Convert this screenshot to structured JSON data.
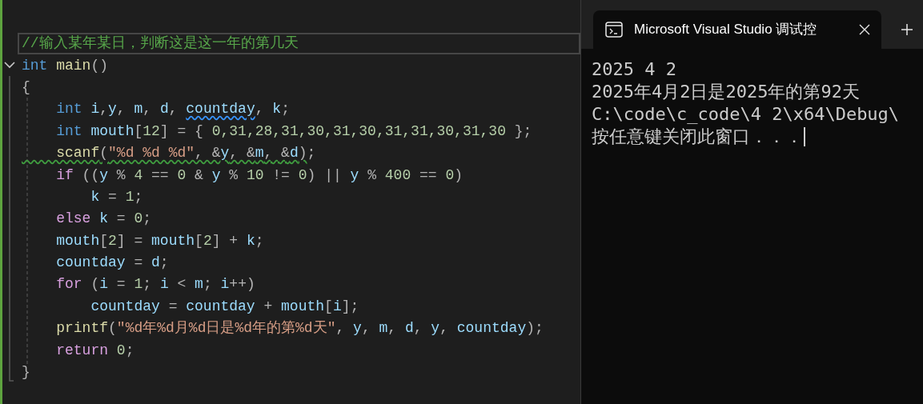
{
  "editor": {
    "lines": [
      {
        "current": true,
        "foldable": false,
        "tokens": [
          {
            "kind": "comment",
            "text": "//输入某年某日，判断这是这一年的第几天"
          }
        ]
      },
      {
        "current": false,
        "foldable": true,
        "tokens": [
          {
            "kind": "keyword",
            "text": "int"
          },
          {
            "kind": "function",
            "text": " main"
          },
          {
            "kind": "plain",
            "text": "()"
          }
        ]
      },
      {
        "current": false,
        "foldable": false,
        "tokens": [
          {
            "kind": "plain",
            "text": "{"
          }
        ]
      },
      {
        "current": false,
        "foldable": false,
        "tokens": [
          {
            "kind": "keyword",
            "text": "    int"
          },
          {
            "kind": "variable",
            "text": " i"
          },
          {
            "kind": "plain",
            "text": ","
          },
          {
            "kind": "variable",
            "text": "y"
          },
          {
            "kind": "plain",
            "text": ", "
          },
          {
            "kind": "variable",
            "text": "m"
          },
          {
            "kind": "plain",
            "text": ", "
          },
          {
            "kind": "variable",
            "text": "d"
          },
          {
            "kind": "plain",
            "text": ", "
          },
          {
            "kind": "variable",
            "text": "countday",
            "suggestion": true
          },
          {
            "kind": "plain",
            "text": ", "
          },
          {
            "kind": "variable",
            "text": "k"
          },
          {
            "kind": "plain",
            "text": ";"
          }
        ]
      },
      {
        "current": false,
        "foldable": false,
        "tokens": [
          {
            "kind": "keyword",
            "text": "    int"
          },
          {
            "kind": "variable",
            "text": " mouth"
          },
          {
            "kind": "plain",
            "text": "["
          },
          {
            "kind": "number",
            "text": "12"
          },
          {
            "kind": "plain",
            "text": "] = { "
          },
          {
            "kind": "number",
            "text": "0,31,28,31,30,31,30,31,31,30,31,30"
          },
          {
            "kind": "plain",
            "text": " };"
          }
        ]
      },
      {
        "current": false,
        "foldable": false,
        "tokens": [
          {
            "kind": "function",
            "text": "    scanf",
            "warning": true
          },
          {
            "kind": "plain",
            "text": "(",
            "warning": true
          },
          {
            "kind": "string",
            "text": "\"%d %d %d\"",
            "warning": true
          },
          {
            "kind": "plain",
            "text": ", &",
            "warning": true
          },
          {
            "kind": "variable",
            "text": "y",
            "warning": true
          },
          {
            "kind": "plain",
            "text": ", &",
            "warning": true
          },
          {
            "kind": "variable",
            "text": "m",
            "warning": true
          },
          {
            "kind": "plain",
            "text": ", &",
            "warning": true
          },
          {
            "kind": "variable",
            "text": "d",
            "warning": true
          },
          {
            "kind": "plain",
            "text": ")",
            "warning": true
          },
          {
            "kind": "plain",
            "text": ";"
          }
        ]
      },
      {
        "current": false,
        "foldable": false,
        "tokens": [
          {
            "kind": "control",
            "text": "    if"
          },
          {
            "kind": "plain",
            "text": " (("
          },
          {
            "kind": "variable",
            "text": "y"
          },
          {
            "kind": "plain",
            "text": " % "
          },
          {
            "kind": "number",
            "text": "4"
          },
          {
            "kind": "plain",
            "text": " == "
          },
          {
            "kind": "number",
            "text": "0"
          },
          {
            "kind": "plain",
            "text": " & "
          },
          {
            "kind": "variable",
            "text": "y"
          },
          {
            "kind": "plain",
            "text": " % "
          },
          {
            "kind": "number",
            "text": "10"
          },
          {
            "kind": "plain",
            "text": " != "
          },
          {
            "kind": "number",
            "text": "0"
          },
          {
            "kind": "plain",
            "text": ") || "
          },
          {
            "kind": "variable",
            "text": "y"
          },
          {
            "kind": "plain",
            "text": " % "
          },
          {
            "kind": "number",
            "text": "400"
          },
          {
            "kind": "plain",
            "text": " == "
          },
          {
            "kind": "number",
            "text": "0"
          },
          {
            "kind": "plain",
            "text": ")"
          }
        ]
      },
      {
        "current": false,
        "foldable": false,
        "tokens": [
          {
            "kind": "variable",
            "text": "        k"
          },
          {
            "kind": "plain",
            "text": " = "
          },
          {
            "kind": "number",
            "text": "1"
          },
          {
            "kind": "plain",
            "text": ";"
          }
        ]
      },
      {
        "current": false,
        "foldable": false,
        "tokens": [
          {
            "kind": "control",
            "text": "    else"
          },
          {
            "kind": "variable",
            "text": " k"
          },
          {
            "kind": "plain",
            "text": " = "
          },
          {
            "kind": "number",
            "text": "0"
          },
          {
            "kind": "plain",
            "text": ";"
          }
        ]
      },
      {
        "current": false,
        "foldable": false,
        "tokens": [
          {
            "kind": "variable",
            "text": "    mouth"
          },
          {
            "kind": "plain",
            "text": "["
          },
          {
            "kind": "number",
            "text": "2"
          },
          {
            "kind": "plain",
            "text": "] = "
          },
          {
            "kind": "variable",
            "text": "mouth"
          },
          {
            "kind": "plain",
            "text": "["
          },
          {
            "kind": "number",
            "text": "2"
          },
          {
            "kind": "plain",
            "text": "] + "
          },
          {
            "kind": "variable",
            "text": "k"
          },
          {
            "kind": "plain",
            "text": ";"
          }
        ]
      },
      {
        "current": false,
        "foldable": false,
        "tokens": [
          {
            "kind": "variable",
            "text": "    countday"
          },
          {
            "kind": "plain",
            "text": " = "
          },
          {
            "kind": "variable",
            "text": "d"
          },
          {
            "kind": "plain",
            "text": ";"
          }
        ]
      },
      {
        "current": false,
        "foldable": false,
        "tokens": [
          {
            "kind": "control",
            "text": "    for"
          },
          {
            "kind": "plain",
            "text": " ("
          },
          {
            "kind": "variable",
            "text": "i"
          },
          {
            "kind": "plain",
            "text": " = "
          },
          {
            "kind": "number",
            "text": "1"
          },
          {
            "kind": "plain",
            "text": "; "
          },
          {
            "kind": "variable",
            "text": "i"
          },
          {
            "kind": "plain",
            "text": " < "
          },
          {
            "kind": "variable",
            "text": "m"
          },
          {
            "kind": "plain",
            "text": "; "
          },
          {
            "kind": "variable",
            "text": "i"
          },
          {
            "kind": "plain",
            "text": "++)"
          }
        ]
      },
      {
        "current": false,
        "foldable": false,
        "tokens": [
          {
            "kind": "variable",
            "text": "        countday"
          },
          {
            "kind": "plain",
            "text": " = "
          },
          {
            "kind": "variable",
            "text": "countday"
          },
          {
            "kind": "plain",
            "text": " + "
          },
          {
            "kind": "variable",
            "text": "mouth"
          },
          {
            "kind": "plain",
            "text": "["
          },
          {
            "kind": "variable",
            "text": "i"
          },
          {
            "kind": "plain",
            "text": "];"
          }
        ]
      },
      {
        "current": false,
        "foldable": false,
        "tokens": [
          {
            "kind": "function",
            "text": "    printf"
          },
          {
            "kind": "plain",
            "text": "("
          },
          {
            "kind": "string",
            "text": "\"%d年%d月%d日是%d年的第%d天\""
          },
          {
            "kind": "plain",
            "text": ", "
          },
          {
            "kind": "variable",
            "text": "y"
          },
          {
            "kind": "plain",
            "text": ", "
          },
          {
            "kind": "variable",
            "text": "m"
          },
          {
            "kind": "plain",
            "text": ", "
          },
          {
            "kind": "variable",
            "text": "d"
          },
          {
            "kind": "plain",
            "text": ", "
          },
          {
            "kind": "variable",
            "text": "y"
          },
          {
            "kind": "plain",
            "text": ", "
          },
          {
            "kind": "variable",
            "text": "countday"
          },
          {
            "kind": "plain",
            "text": ");"
          }
        ]
      },
      {
        "current": false,
        "foldable": false,
        "tokens": [
          {
            "kind": "control",
            "text": "    return"
          },
          {
            "kind": "number",
            "text": " 0"
          },
          {
            "kind": "plain",
            "text": ";"
          }
        ]
      },
      {
        "current": false,
        "foldable": false,
        "tokens": [
          {
            "kind": "plain",
            "text": "}"
          }
        ]
      }
    ]
  },
  "terminal": {
    "tab_title": "Microsoft Visual Studio 调试控",
    "output_lines": [
      "2025 4 2",
      "2025年4月2日是2025年的第92天",
      "C:\\code\\c_code\\4 2\\x64\\Debug\\",
      "按任意键关闭此窗口．．．"
    ]
  }
}
